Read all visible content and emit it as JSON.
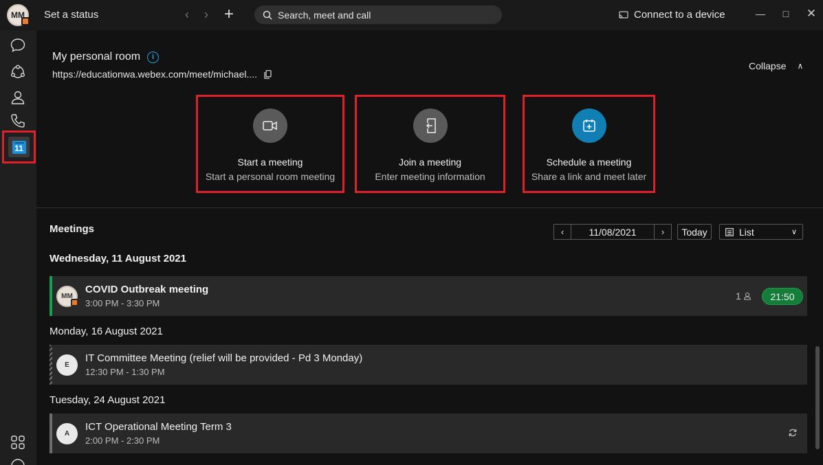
{
  "titlebar": {
    "avatar_initials": "MM",
    "status_label": "Set a status",
    "search_placeholder": "Search, meet and call",
    "connect_label": "Connect to a device"
  },
  "rail": {
    "calendar_day": "11"
  },
  "personal_room": {
    "title": "My personal room",
    "url": "https://educationwa.webex.com/meet/michael....",
    "collapse_label": "Collapse"
  },
  "actions": [
    {
      "title": "Start a meeting",
      "subtitle": "Start a personal room meeting"
    },
    {
      "title": "Join a meeting",
      "subtitle": "Enter meeting information"
    },
    {
      "title": "Schedule a meeting",
      "subtitle": "Share a link and meet later"
    }
  ],
  "meetings": {
    "heading": "Meetings",
    "date": "11/08/2021",
    "today_label": "Today",
    "view_label": "List",
    "days": [
      {
        "label": "Wednesday, 11 August 2021",
        "items": [
          {
            "title": "COVID Outbreak meeting",
            "time": "3:00 PM - 3:30 PM",
            "avatar": "MM",
            "participants": "1",
            "timer": "21:50"
          }
        ]
      },
      {
        "label": "Monday, 16 August 2021",
        "items": [
          {
            "title": "IT Committee Meeting (relief will be provided - Pd 3 Monday)",
            "time": "12:30 PM - 1:30 PM",
            "avatar": "E"
          }
        ]
      },
      {
        "label": "Tuesday, 24 August 2021",
        "items": [
          {
            "title": "ICT Operational Meeting Term 3",
            "time": "2:00 PM - 2:30 PM",
            "avatar": "A"
          }
        ]
      }
    ]
  },
  "colors": {
    "highlight": "#e0212a",
    "accent_blue": "#1c8fd6",
    "live_green": "#12a150"
  }
}
